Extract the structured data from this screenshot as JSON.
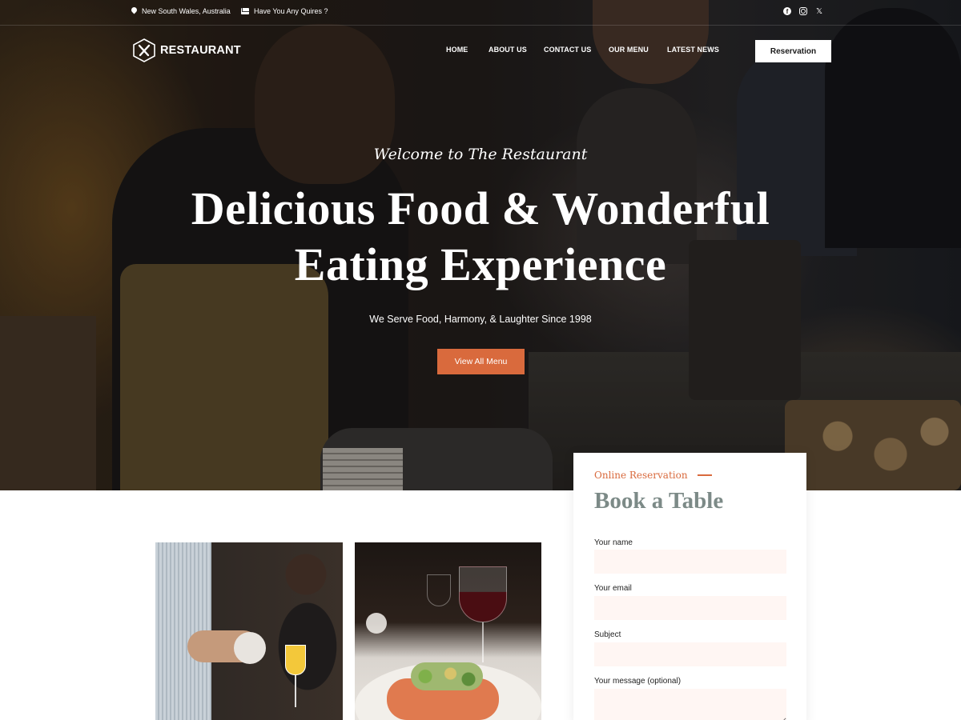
{
  "topbar": {
    "location": "New South Wales, Australia",
    "email_text": "Have You Any Quires ?",
    "socials": [
      "facebook-icon",
      "instagram-icon",
      "x-icon"
    ]
  },
  "header": {
    "logo_text": "RESTAURANT",
    "nav": [
      "HOME",
      "ABOUT US",
      "CONTACT US",
      "OUR MENU",
      "LATEST NEWS"
    ],
    "reservation_button": "Reservation"
  },
  "hero": {
    "kicker": "Welcome to The Restaurant",
    "headline": "Delicious Food & Wonderful Eating Experience",
    "subline": "We Serve Food, Harmony, & Laughter Since 1998",
    "cta": "View All Menu"
  },
  "booking": {
    "kicker": "Online Reservation",
    "title": "Book a Table",
    "fields": [
      {
        "label": "Your name",
        "value": ""
      },
      {
        "label": "Your email",
        "value": ""
      },
      {
        "label": "Subject",
        "value": ""
      },
      {
        "label": "Your message (optional)",
        "value": ""
      }
    ]
  },
  "colors": {
    "accent": "#d96a3d",
    "title_gray": "#7c8a87",
    "input_bg": "#fff6f3"
  }
}
